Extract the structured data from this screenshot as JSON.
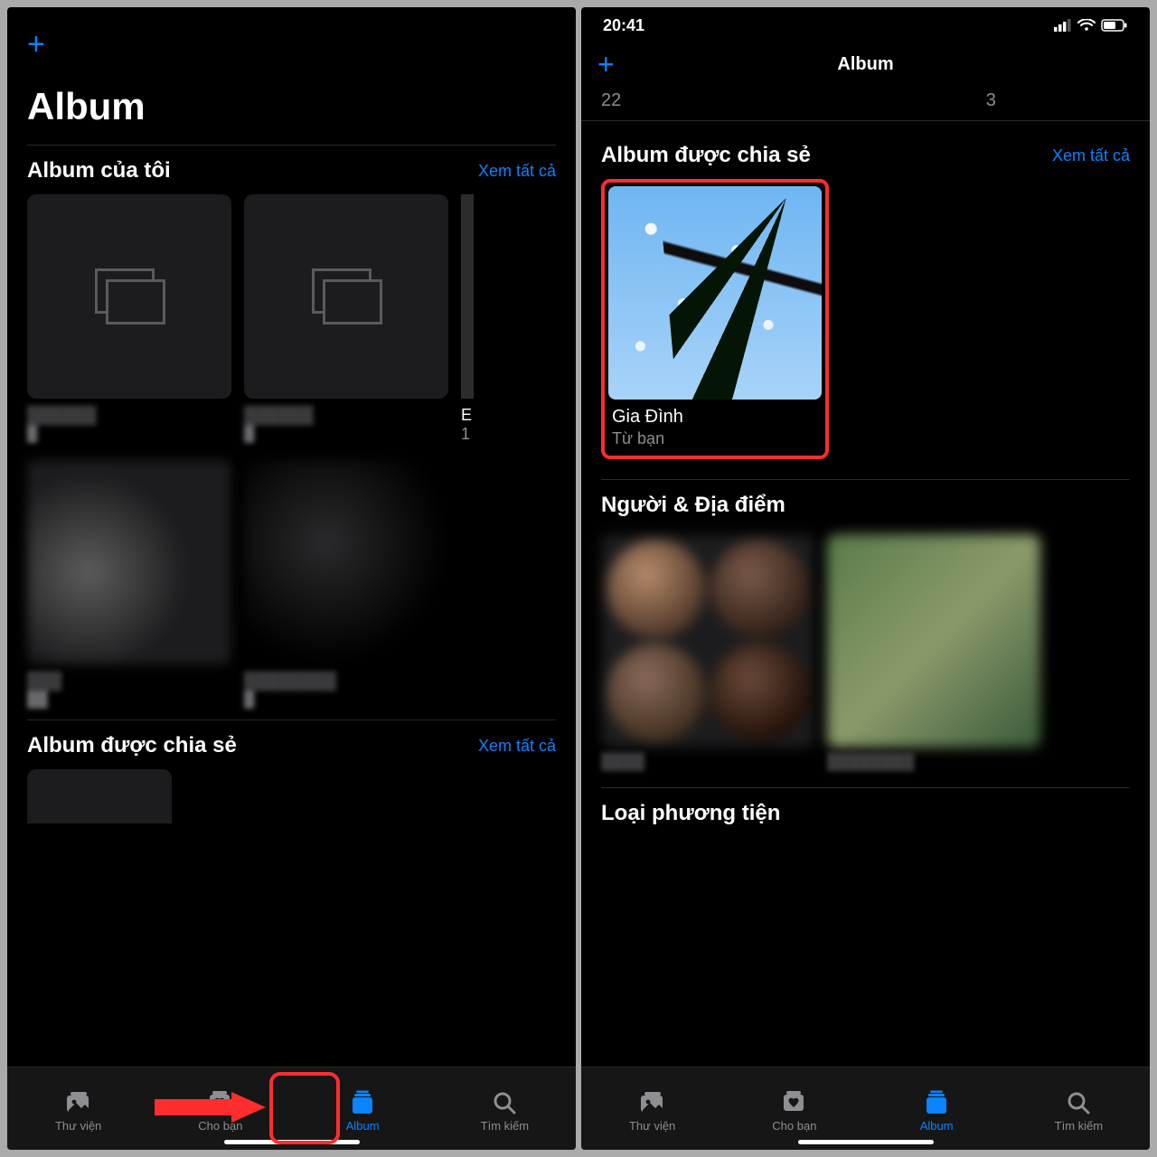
{
  "left": {
    "header_plus": "+",
    "big_title": "Album",
    "sections": {
      "my_albums": {
        "title": "Album của tôi",
        "see_all": "Xem tất cả",
        "peek_letter": "E",
        "peek_count": "1"
      },
      "shared": {
        "title": "Album được chia sẻ",
        "see_all": "Xem tất cả"
      }
    },
    "tabs": {
      "library": "Thư viện",
      "for_you": "Cho bạn",
      "albums": "Album",
      "search": "Tìm kiếm"
    }
  },
  "right": {
    "statusbar": {
      "time": "20:41"
    },
    "nav_title": "Album",
    "header_plus": "+",
    "counts": {
      "left": "22",
      "mid": "3"
    },
    "sections": {
      "shared": {
        "title": "Album được chia sẻ",
        "see_all": "Xem tất cả"
      },
      "people_places": {
        "title": "Người & Địa điểm"
      },
      "media_types": {
        "title": "Loại phương tiện"
      }
    },
    "shared_album": {
      "name": "Gia Đình",
      "from": "Từ bạn"
    },
    "tabs": {
      "library": "Thư viện",
      "for_you": "Cho bạn",
      "albums": "Album",
      "search": "Tìm kiếm"
    }
  }
}
